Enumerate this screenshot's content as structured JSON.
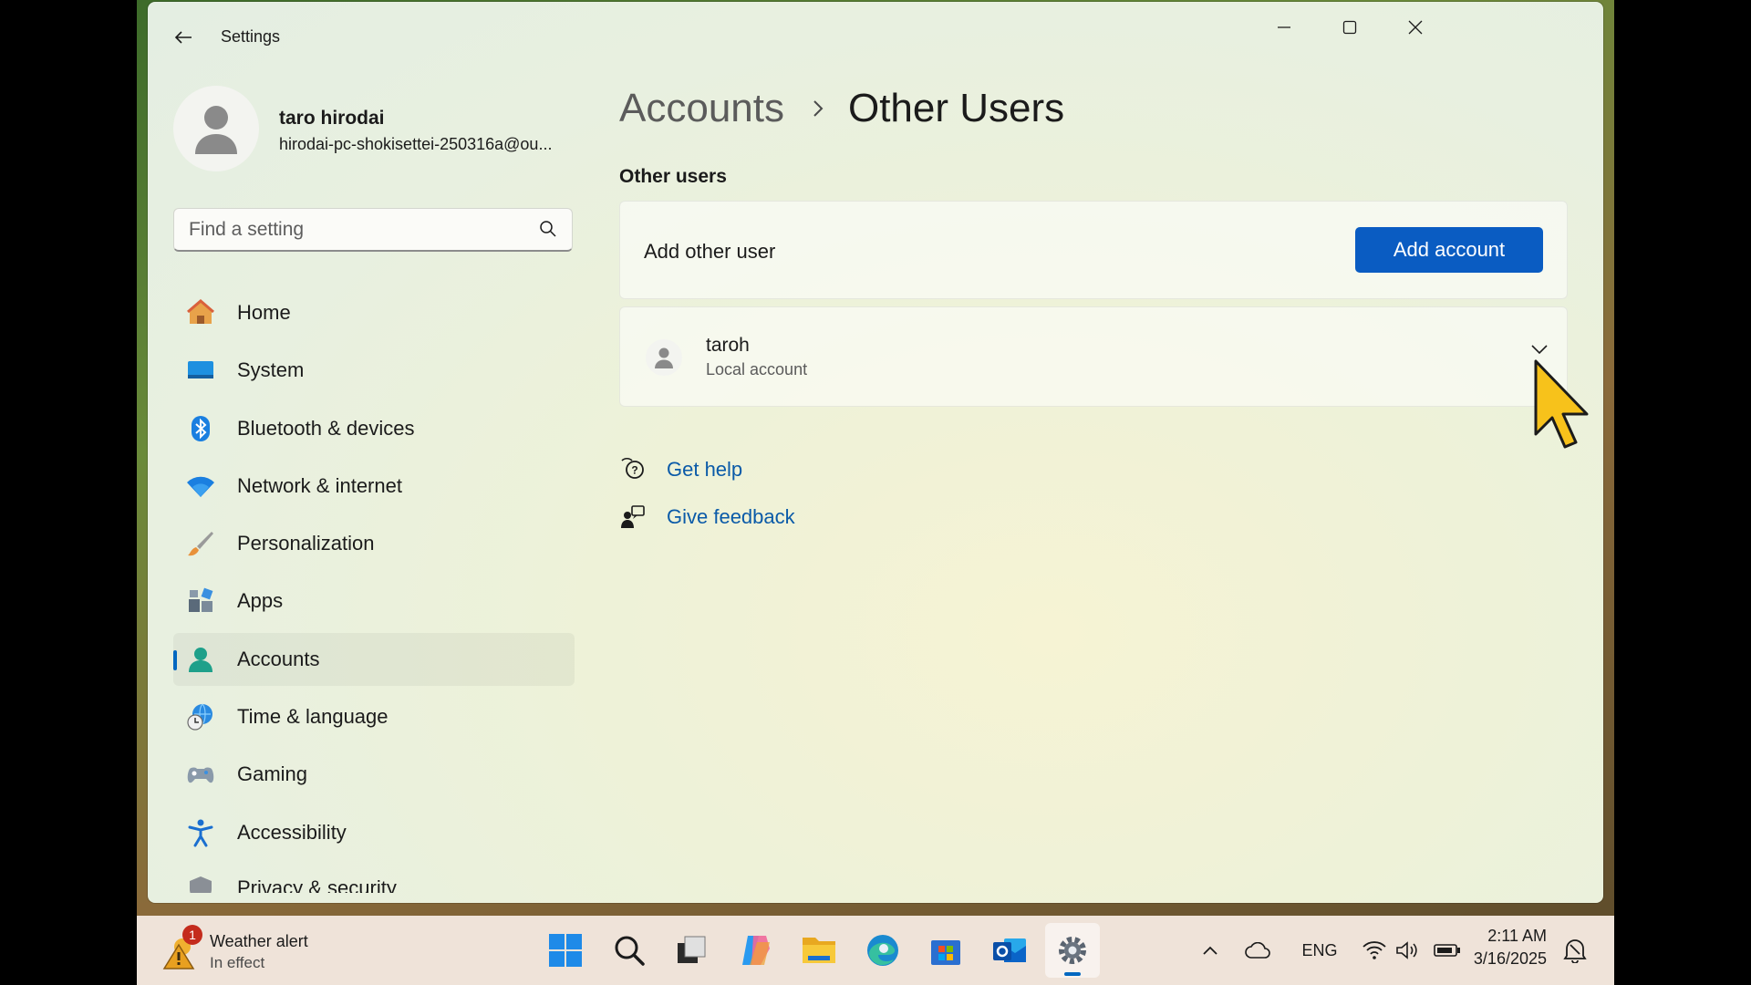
{
  "window": {
    "title": "Settings",
    "controls": [
      "minimize",
      "maximize",
      "close"
    ]
  },
  "profile": {
    "name": "taro hirodai",
    "email": "hirodai-pc-shokisettei-250316a@ou..."
  },
  "search": {
    "placeholder": "Find a setting",
    "value": ""
  },
  "sidebar": {
    "items": [
      {
        "label": "Home",
        "icon": "home-icon"
      },
      {
        "label": "System",
        "icon": "system-icon"
      },
      {
        "label": "Bluetooth & devices",
        "icon": "bluetooth-icon"
      },
      {
        "label": "Network & internet",
        "icon": "wifi-icon"
      },
      {
        "label": "Personalization",
        "icon": "brush-icon"
      },
      {
        "label": "Apps",
        "icon": "apps-icon"
      },
      {
        "label": "Accounts",
        "icon": "accounts-icon",
        "active": true
      },
      {
        "label": "Time & language",
        "icon": "globe-clock-icon"
      },
      {
        "label": "Gaming",
        "icon": "gamepad-icon"
      },
      {
        "label": "Accessibility",
        "icon": "accessibility-icon"
      },
      {
        "label": "Privacy & security",
        "icon": "shield-icon"
      }
    ]
  },
  "breadcrumb": {
    "parent": "Accounts",
    "current": "Other Users"
  },
  "other_users": {
    "section_title": "Other users",
    "add_label": "Add other user",
    "add_button": "Add account",
    "users": [
      {
        "name": "taroh",
        "type": "Local account"
      }
    ]
  },
  "links": {
    "help": "Get help",
    "feedback": "Give feedback"
  },
  "taskbar": {
    "weather_title": "Weather alert",
    "weather_sub": "In effect",
    "weather_badge": "1",
    "apps": [
      "start-icon",
      "search-icon",
      "task-view-icon",
      "copilot-icon",
      "file-explorer-icon",
      "edge-icon",
      "store-icon",
      "outlook-icon",
      "settings-icon"
    ],
    "language": "ENG",
    "time": "2:11 AM",
    "date": "3/16/2025"
  },
  "colors": {
    "accent": "#0a5cc2",
    "link": "#0a5aa8",
    "nav_indicator": "#0067c0"
  }
}
